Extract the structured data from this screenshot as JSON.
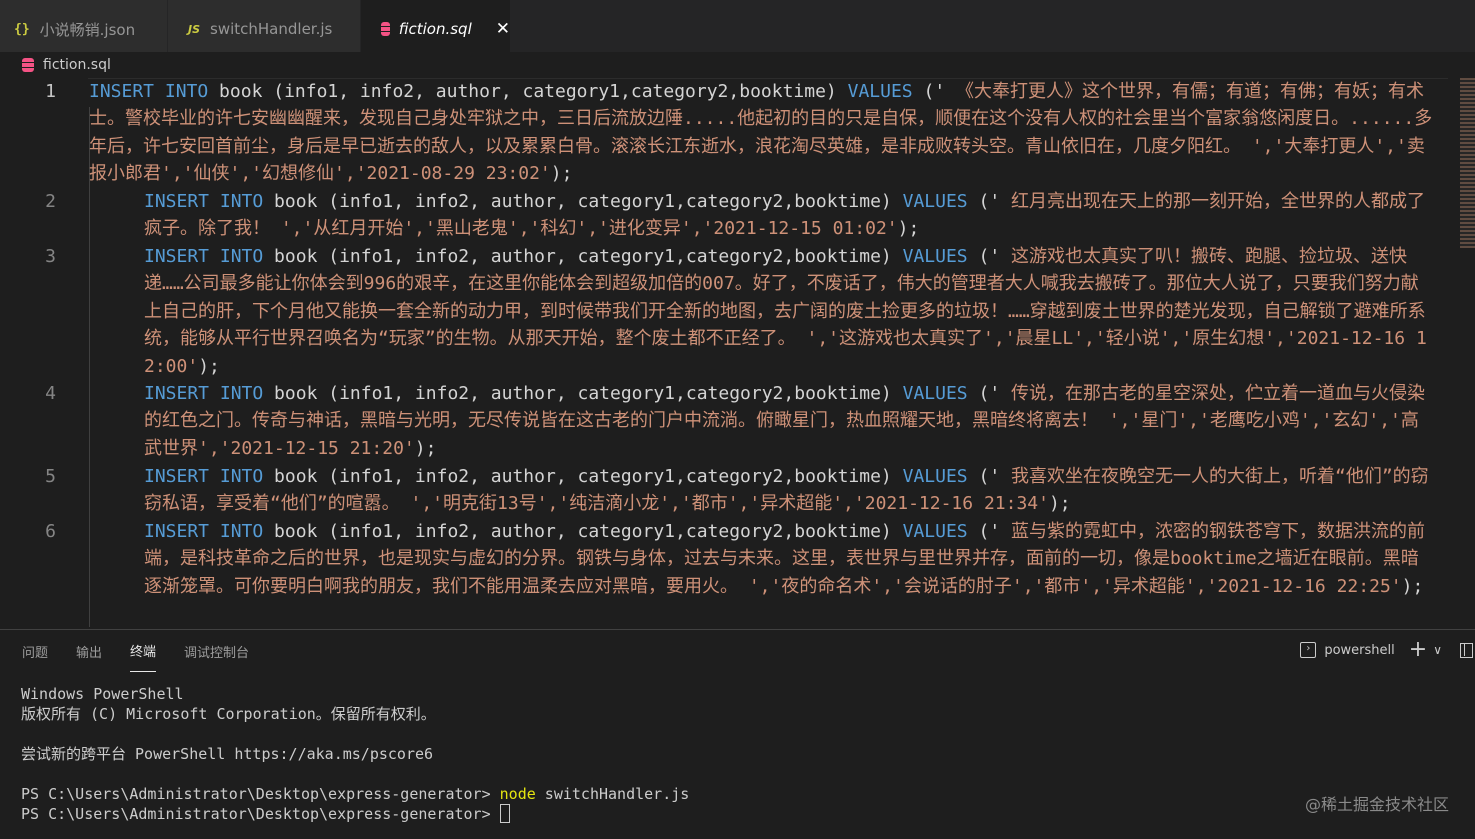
{
  "tabs": [
    {
      "icon": "{}",
      "label": "小说畅销.json",
      "active": false
    },
    {
      "icon": "JS",
      "label": "switchHandler.js",
      "active": false
    },
    {
      "icon": "",
      "label": "fiction.sql",
      "active": true,
      "close": "✕"
    }
  ],
  "breadcrumb": {
    "file": "fiction.sql"
  },
  "editor": {
    "lines": [
      {
        "num": "1",
        "prefix": "INSERT INTO",
        "columns": " book (info1, info2, author, category1,category2,booktime) ",
        "values_kw": "VALUES",
        "open": " ('",
        "text": " 《大奉打更人》这个世界，有儒；有道；有佛；有妖；有术士。警校毕业的许七安幽幽醒来，发现自己身处牢狱之中，三日后流放边陲.....他起初的目的只是自保，顺便在这个没有人权的社会里当个富家翁悠闲度日。......多年后，许七安回首前尘，身后是早已逝去的敌人，以及累累白骨。滚滚长江东逝水，浪花淘尽英雄，是非成败转头空。青山依旧在，几度夕阳红。 ','大奉打更人','卖报小郎君','仙侠','幻想修仙','2021-08-29 23:02'",
        "close": ");"
      },
      {
        "num": "2",
        "prefix": "INSERT INTO",
        "columns": " book (info1, info2, author, category1,category2,booktime) ",
        "values_kw": "VALUES",
        "open": " ('",
        "text": " 红月亮出现在天上的那一刻开始，全世界的人都成了疯子。除了我！ ','从红月开始','黑山老鬼','科幻','进化变异','2021-12-15 01:02'",
        "close": ");"
      },
      {
        "num": "3",
        "prefix": "INSERT INTO",
        "columns": " book (info1, info2, author, category1,category2,booktime) ",
        "values_kw": "VALUES",
        "open": " ('",
        "text": " 这游戏也太真实了叭！搬砖、跑腿、捡垃圾、送快递……公司最多能让你体会到996的艰辛，在这里你能体会到超级加倍的007。好了，不废话了，伟大的管理者大人喊我去搬砖了。那位大人说了，只要我们努力献上自己的肝，下个月他又能换一套全新的动力甲，到时候带我们开全新的地图，去广阔的废土捡更多的垃圾！……穿越到废土世界的楚光发现，自己解锁了避难所系统，能够从平行世界召唤名为“玩家”的生物。从那天开始，整个废土都不正经了。 ','这游戏也太真实了','晨星LL','轻小说','原生幻想','2021-12-16 12:00'",
        "close": ");"
      },
      {
        "num": "4",
        "prefix": "INSERT INTO",
        "columns": " book (info1, info2, author, category1,category2,booktime) ",
        "values_kw": "VALUES",
        "open": " ('",
        "text": " 传说，在那古老的星空深处，伫立着一道血与火侵染的红色之门。传奇与神话，黑暗与光明，无尽传说皆在这古老的门户中流淌。俯瞰星门，热血照耀天地，黑暗终将离去！ ','星门','老鹰吃小鸡','玄幻','高武世界','2021-12-15 21:20'",
        "close": ");"
      },
      {
        "num": "5",
        "prefix": "INSERT INTO",
        "columns": " book (info1, info2, author, category1,category2,booktime) ",
        "values_kw": "VALUES",
        "open": " ('",
        "text": " 我喜欢坐在夜晚空无一人的大街上，听着“他们”的窃窃私语，享受着“他们”的喧嚣。 ','明克街13号','纯洁滴小龙','都市','异术超能','2021-12-16 21:34'",
        "close": ");"
      },
      {
        "num": "6",
        "prefix": "INSERT INTO",
        "columns": " book (info1, info2, author, category1,category2,booktime) ",
        "values_kw": "VALUES",
        "open": " ('",
        "text": " 蓝与紫的霓虹中，浓密的钢铁苍穹下，数据洪流的前端，是科技革命之后的世界，也是现实与虚幻的分界。钢铁与身体，过去与未来。这里，表世界与里世界并存，面前的一切，像是booktime之墙近在眼前。黑暗逐渐笼罩。可你要明白啊我的朋友，我们不能用温柔去应对黑暗，要用火。 ','夜的命名术','会说话的肘子','都市','异术超能','2021-12-16 22:25'",
        "close": ");"
      }
    ]
  },
  "panel": {
    "tabs": [
      "问题",
      "输出",
      "终端",
      "调试控制台"
    ],
    "active_tab": "终端",
    "shell_label": "powershell",
    "plus": "+",
    "chevron": "∨"
  },
  "terminal": {
    "lines": [
      "Windows PowerShell",
      "版权所有 (C) Microsoft Corporation。保留所有权利。",
      "",
      "尝试新的跨平台 PowerShell https://aka.ms/pscore6",
      ""
    ],
    "prompt1": "PS C:\\Users\\Administrator\\Desktop\\express-generator> ",
    "cmd_name": "node",
    "cmd_args": " switchHandler.js",
    "prompt2": "PS C:\\Users\\Administrator\\Desktop\\express-generator> "
  },
  "watermark": "@稀土掘金技术社区"
}
